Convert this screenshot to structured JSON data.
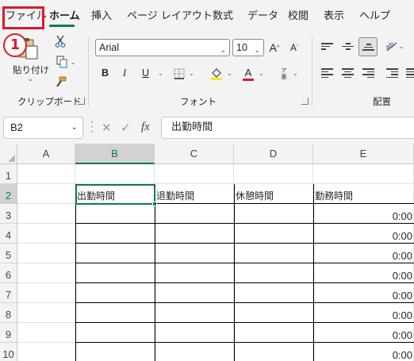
{
  "menu": {
    "tabs": [
      {
        "label": "ファイル"
      },
      {
        "label": "ホーム"
      },
      {
        "label": "挿入"
      },
      {
        "label": "ページ レイアウト"
      },
      {
        "label": "数式"
      },
      {
        "label": "データ"
      },
      {
        "label": "校閲"
      },
      {
        "label": "表示"
      },
      {
        "label": "ヘルプ"
      }
    ]
  },
  "annotation": {
    "step": "1"
  },
  "ribbon": {
    "clipboard": {
      "paste_label": "貼り付け",
      "group_label": "クリップボード"
    },
    "font": {
      "font_name": "Arial",
      "font_size": "10",
      "group_label": "フォント",
      "font_color": "#e0182d",
      "fill_color": "#ffe600"
    },
    "alignment": {
      "group_label": "配置"
    }
  },
  "formula_bar": {
    "name_box": "B2",
    "fx": "fx",
    "formula": "出勤時間"
  },
  "grid": {
    "columns": [
      "A",
      "B",
      "C",
      "D",
      "E"
    ],
    "rows": [
      "1",
      "2",
      "3",
      "4",
      "5",
      "6",
      "7",
      "8",
      "9",
      "10"
    ],
    "headers": {
      "B2": "出勤時間",
      "C2": "退勤時間",
      "D2": "休憩時間",
      "E2": "勤務時間"
    },
    "e_values": [
      "0:00",
      "0:00",
      "0:00",
      "0:00",
      "0:00",
      "0:00",
      "0:00",
      "0:00"
    ]
  },
  "colors": {
    "accent": "#107c41",
    "highlight": "#e0182d"
  }
}
